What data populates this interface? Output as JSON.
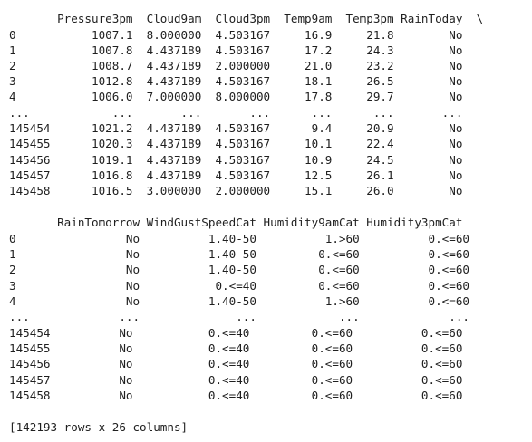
{
  "output": {
    "block1": {
      "header": "       Pressure3pm  Cloud9am  Cloud3pm  Temp9am  Temp3pm RainToday  \\",
      "rows": [
        "0           1007.1  8.000000  4.503167     16.9     21.8        No",
        "1           1007.8  4.437189  4.503167     17.2     24.3        No",
        "2           1008.7  4.437189  2.000000     21.0     23.2        No",
        "3           1012.8  4.437189  4.503167     18.1     26.5        No",
        "4           1006.0  7.000000  8.000000     17.8     29.7        No",
        "...            ...       ...       ...      ...      ...       ...",
        "145454      1021.2  4.437189  4.503167      9.4     20.9        No",
        "145455      1020.3  4.437189  4.503167     10.1     22.4        No",
        "145456      1019.1  4.437189  4.503167     10.9     24.5        No",
        "145457      1016.8  4.437189  4.503167     12.5     26.1        No",
        "145458      1016.5  3.000000  2.000000     15.1     26.0        No"
      ]
    },
    "block2": {
      "header": "       RainTomorrow WindGustSpeedCat Humidity9amCat Humidity3pmCat",
      "rows": [
        "0                No          1.40-50          1.>60          0.<=60",
        "1                No          1.40-50         0.<=60          0.<=60",
        "2                No          1.40-50         0.<=60          0.<=60",
        "3                No           0.<=40         0.<=60          0.<=60",
        "4                No          1.40-50          1.>60          0.<=60",
        "...             ...              ...            ...             ...",
        "145454          No           0.<=40         0.<=60          0.<=60",
        "145455          No           0.<=40         0.<=60          0.<=60",
        "145456          No           0.<=40         0.<=60          0.<=60",
        "145457          No           0.<=40         0.<=60          0.<=60",
        "145458          No           0.<=40         0.<=60          0.<=60"
      ]
    },
    "summary": "[142193 rows x 26 columns]"
  }
}
